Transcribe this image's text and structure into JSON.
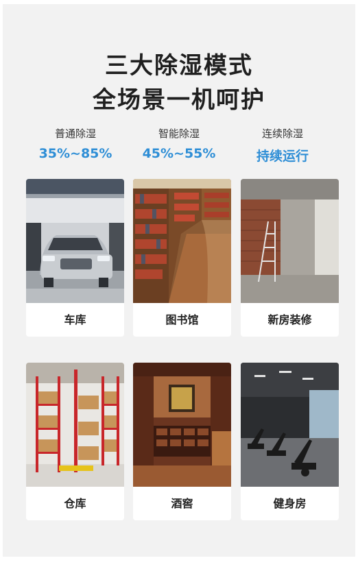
{
  "headline": {
    "line1": "三大除湿模式",
    "line2": "全场景一机呵护"
  },
  "modes": [
    {
      "label": "普通除湿",
      "value": "35%~85%"
    },
    {
      "label": "智能除湿",
      "value": "45%~55%"
    },
    {
      "label": "连续除湿",
      "value": "持续运行"
    }
  ],
  "scenes": [
    {
      "caption": "车库"
    },
    {
      "caption": "图书馆"
    },
    {
      "caption": "新房装修"
    },
    {
      "caption": "仓库"
    },
    {
      "caption": "酒窖"
    },
    {
      "caption": "健身房"
    }
  ],
  "colors": {
    "accent": "#2e8ed6",
    "background": "#f2f2f2"
  }
}
